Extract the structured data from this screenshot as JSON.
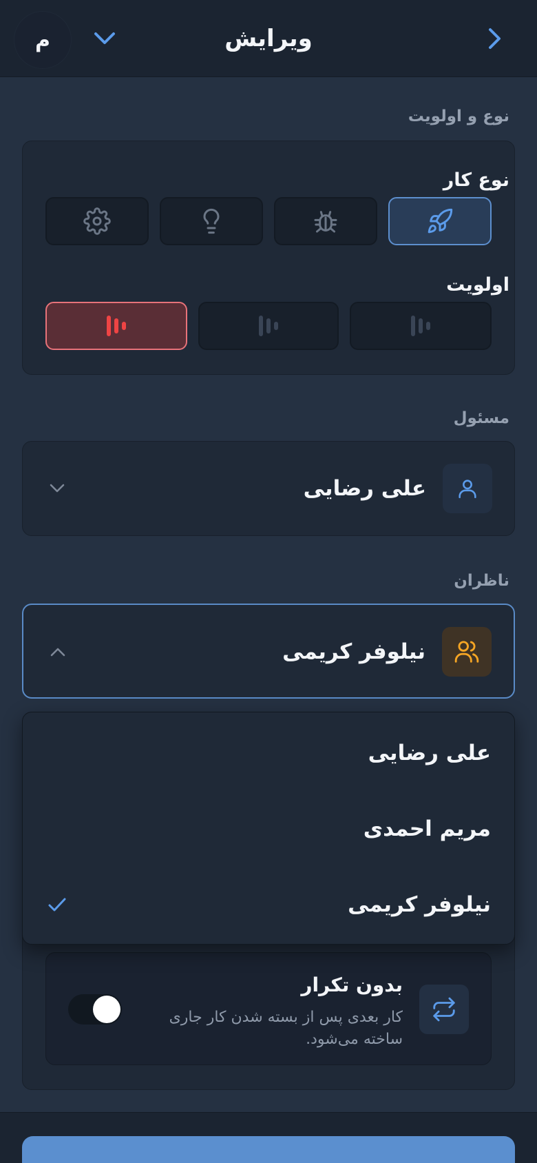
{
  "header": {
    "title": "ویرایش",
    "avatar_initial": "م",
    "back_icon": "chevron-right-icon",
    "menu_icon": "chevron-down-icon"
  },
  "type_priority": {
    "section_title": "نوع و اولویت",
    "type_label": "نوع کار",
    "types": [
      {
        "icon": "rocket-icon",
        "selected": true
      },
      {
        "icon": "bug-icon",
        "selected": false
      },
      {
        "icon": "lightbulb-icon",
        "selected": false
      },
      {
        "icon": "gear-icon",
        "selected": false
      }
    ],
    "priority_label": "اولویت",
    "priorities": [
      {
        "icon": "priority-low-icon",
        "selected": false
      },
      {
        "icon": "priority-medium-icon",
        "selected": false
      },
      {
        "icon": "priority-high-icon",
        "selected": true
      }
    ]
  },
  "assignee": {
    "section_title": "مسئول",
    "value": "علی رضایی",
    "icon": "user-icon"
  },
  "watchers": {
    "section_title": "ناظران",
    "value": "نیلوفر کریمی",
    "icon": "users-icon",
    "options": [
      {
        "label": "علی رضایی",
        "selected": false
      },
      {
        "label": "مریم احمدی",
        "selected": false
      },
      {
        "label": "نیلوفر کریمی",
        "selected": true
      }
    ]
  },
  "recurrence": {
    "title": "بدون تکرار",
    "description": "کار بعدی پس از بسته شدن کار جاری ساخته می‌شود.",
    "icon": "repeat-icon",
    "enabled": true
  },
  "colors": {
    "accent": "#5b8fcf",
    "danger": "#ef4444",
    "warning": "#f5a524",
    "background": "#253142",
    "card": "#1f2937"
  }
}
